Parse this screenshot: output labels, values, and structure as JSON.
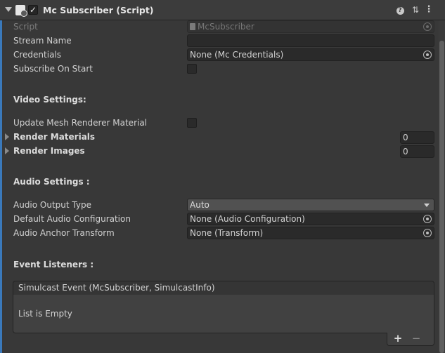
{
  "header": {
    "title": "Mc Subscriber (Script)",
    "enabled": true,
    "icons": [
      "foldout-arrow-icon",
      "script-icon",
      "help-icon",
      "preset-icon",
      "context-menu-icon"
    ]
  },
  "fields": {
    "script": {
      "label": "Script",
      "value": "McSubscriber"
    },
    "stream_name": {
      "label": "Stream Name",
      "value": ""
    },
    "credentials": {
      "label": "Credentials",
      "value": "None (Mc Credentials)"
    },
    "subscribe_on_start": {
      "label": "Subscribe On Start",
      "checked": false
    }
  },
  "video": {
    "header": "Video Settings:",
    "update_mesh": {
      "label": "Update Mesh Renderer Material",
      "checked": false
    },
    "render_materials": {
      "label": "Render Materials",
      "count": "0"
    },
    "render_images": {
      "label": "Render Images",
      "count": "0"
    }
  },
  "audio": {
    "header": "Audio Settings :",
    "output_type": {
      "label": "Audio Output Type",
      "value": "Auto"
    },
    "default_config": {
      "label": "Default Audio Configuration",
      "value": "None (Audio Configuration)"
    },
    "anchor_transform": {
      "label": "Audio Anchor Transform",
      "value": "None (Transform)"
    }
  },
  "events": {
    "header": "Event Listeners :",
    "event_title": "Simulcast Event (McSubscriber, SimulcastInfo)",
    "empty_text": "List is Empty",
    "add_label": "+",
    "remove_label": "−"
  },
  "colors": {
    "background": "#383838",
    "field": "#2a2a2a",
    "accent": "#3a79bb",
    "text": "#d2d2d2"
  }
}
